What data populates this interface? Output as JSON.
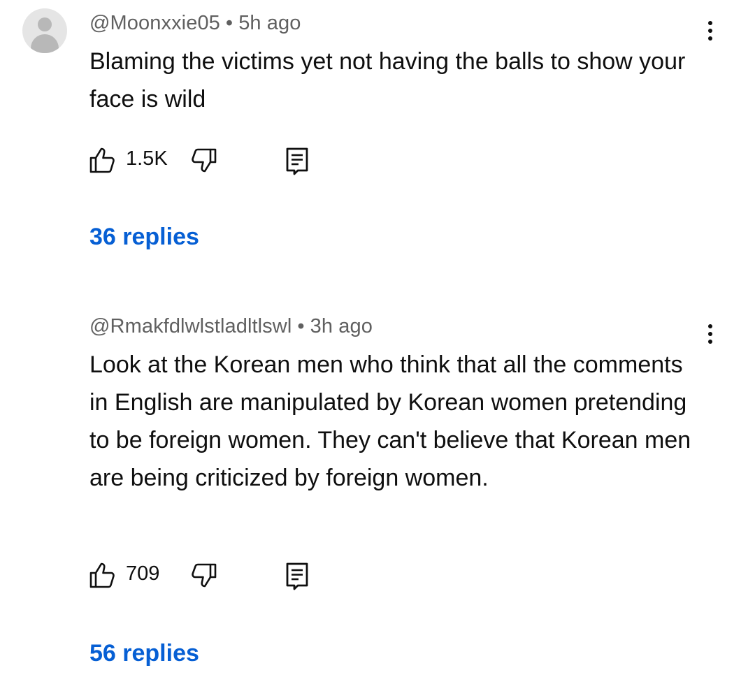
{
  "comments": [
    {
      "handle": "@Moonxxie05",
      "separator": "•",
      "time": "5h ago",
      "text": "Blaming the victims yet not having the balls to show your face is wild",
      "likes": "1.5K",
      "replies": "36 replies",
      "has_avatar": true
    },
    {
      "handle": "@Rmakfdlwlstladltlswl",
      "separator": "•",
      "time": "3h ago",
      "text": "Look at the Korean men who think that all the comments in English are manipulated by Korean women pretending to be foreign women. They can't believe that Korean men are being criticized by foreign women.",
      "likes": "709",
      "replies": "56 replies",
      "has_avatar": false
    }
  ],
  "icons": {
    "like": "thumbs-up-icon",
    "dislike": "thumbs-down-icon",
    "reply": "reply-comment-icon",
    "menu": "more-vert-icon",
    "avatar": "default-avatar-icon"
  },
  "colors": {
    "meta_text": "#606060",
    "body_text": "#0f0f0f",
    "link_blue": "#065fd4",
    "avatar_bg": "#e5e5e5"
  }
}
